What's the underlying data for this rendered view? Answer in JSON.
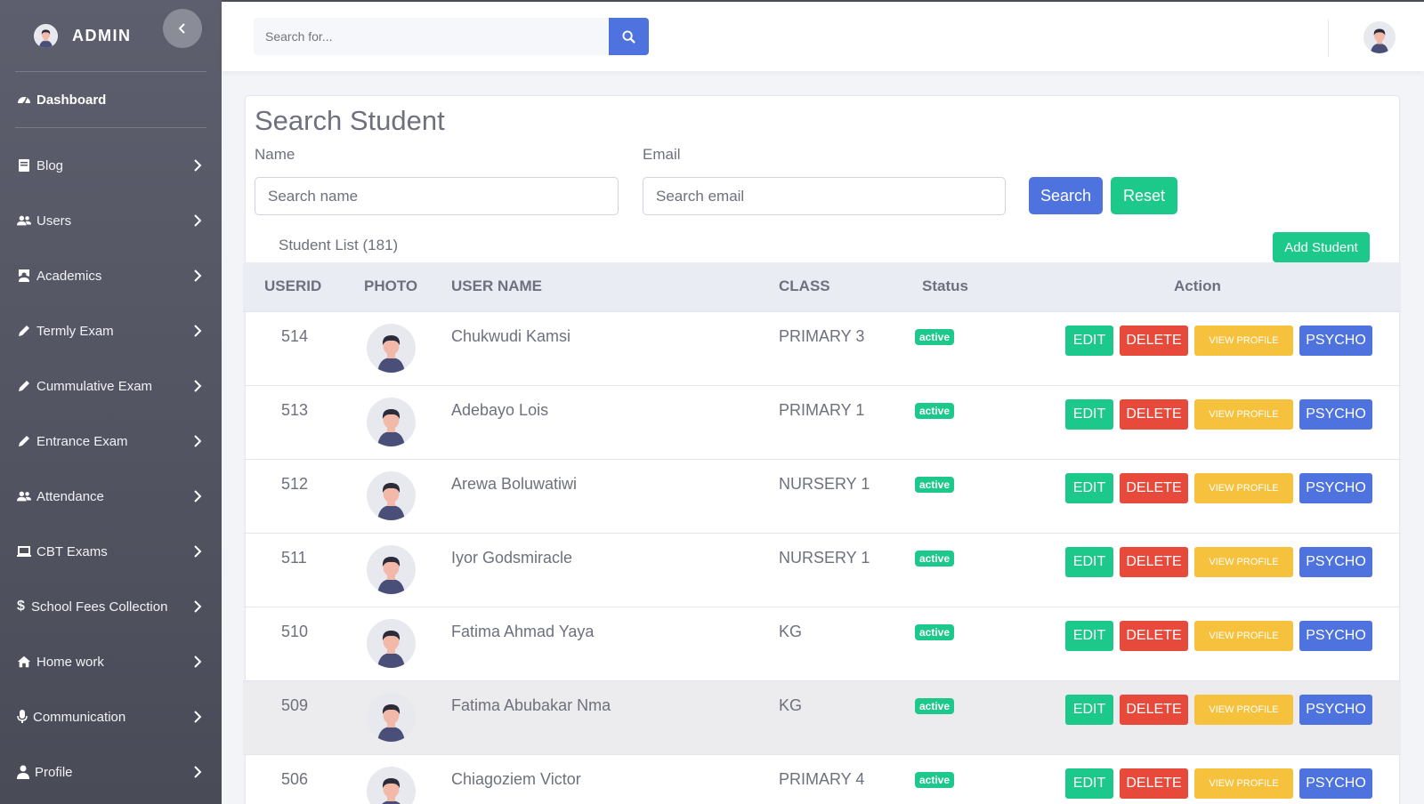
{
  "sidebar": {
    "brand": "ADMIN",
    "dashboard": "Dashboard",
    "items": [
      {
        "label": "Blog",
        "icon": "book-icon"
      },
      {
        "label": "Users",
        "icon": "users-icon"
      },
      {
        "label": "Academics",
        "icon": "teacher-icon"
      },
      {
        "label": "Termly Exam",
        "icon": "pencil-icon"
      },
      {
        "label": "Cummulative Exam",
        "icon": "pencil-icon"
      },
      {
        "label": "Entrance Exam",
        "icon": "pencil-icon"
      },
      {
        "label": "Attendance",
        "icon": "users-icon"
      },
      {
        "label": "CBT Exams",
        "icon": "laptop-icon"
      },
      {
        "label": "School Fees Collection",
        "icon": "dollar-icon"
      },
      {
        "label": "Home work",
        "icon": "home-icon"
      },
      {
        "label": "Communication",
        "icon": "microphone-icon"
      },
      {
        "label": "Profile",
        "icon": "user-icon"
      }
    ]
  },
  "topbar": {
    "search_placeholder": "Search for..."
  },
  "main": {
    "title": "Search Student",
    "name_label": "Name",
    "name_placeholder": "Search name",
    "email_label": "Email",
    "email_placeholder": "Search email",
    "search_button": "Search",
    "reset_button": "Reset",
    "list_count": "Student List (181)",
    "add_button": "Add Student",
    "table": {
      "headers": [
        "USERID",
        "PHOTO",
        "USER NAME",
        "CLASS",
        "Status",
        "Action"
      ],
      "rows": [
        {
          "id": "514",
          "name": "Chukwudi Kamsi",
          "class": "PRIMARY 3",
          "status": "active"
        },
        {
          "id": "513",
          "name": "Adebayo Lois",
          "class": "PRIMARY 1",
          "status": "active"
        },
        {
          "id": "512",
          "name": "Arewa Boluwatiwi",
          "class": "NURSERY 1",
          "status": "active"
        },
        {
          "id": "511",
          "name": "Iyor Godsmiracle",
          "class": "NURSERY 1",
          "status": "active"
        },
        {
          "id": "510",
          "name": "Fatima Ahmad Yaya",
          "class": "KG",
          "status": "active"
        },
        {
          "id": "509",
          "name": "Fatima Abubakar Nma",
          "class": "KG",
          "status": "active"
        },
        {
          "id": "506",
          "name": "Chiagoziem Victor",
          "class": "PRIMARY 4",
          "status": "active"
        }
      ],
      "actions": {
        "edit": "EDIT",
        "delete": "DELETE",
        "view": "VIEW PROFILE",
        "psycho": "PSYCHO"
      }
    }
  },
  "colors": {
    "primary": "#4e73df",
    "success": "#1cc88a",
    "danger": "#e74a3b",
    "warning": "#f6c23e",
    "sidebar": "#555766"
  }
}
